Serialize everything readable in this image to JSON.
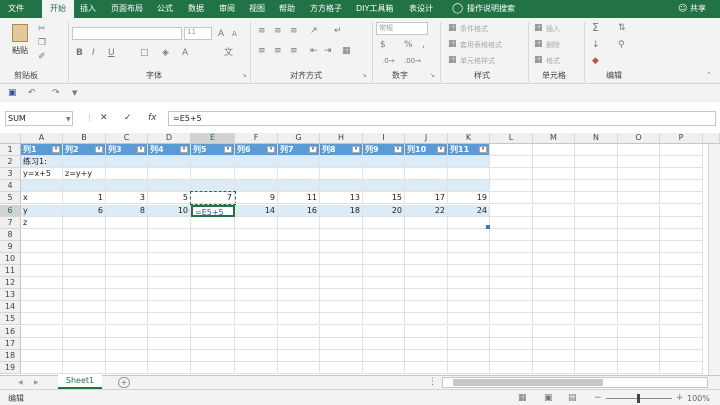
{
  "menu": {
    "file": "文件",
    "home": "开始",
    "insert": "插入",
    "page_layout": "页面布局",
    "formulas": "公式",
    "data": "数据",
    "review": "审阅",
    "view": "视图",
    "help": "帮助",
    "ffgz": "方方格子",
    "diy": "DIY工具箱",
    "design": "表设计",
    "tellme": "操作说明搜索",
    "share": "共享"
  },
  "ribbon": {
    "clipboard": {
      "paste": "粘贴",
      "label": "剪贴板"
    },
    "font": {
      "size": "11",
      "bold": "B",
      "italic": "I",
      "underline": "U",
      "grow": "A",
      "shrink": "A",
      "color_a": "A",
      "wen": "文",
      "label": "字体"
    },
    "alignment": {
      "label": "对齐方式"
    },
    "number": {
      "format": "常规",
      "currency": "$",
      "percent": "%",
      "comma": ",",
      "label": "数字"
    },
    "styles": {
      "cond": "条件格式",
      "table": "套用表格格式",
      "cell": "单元格样式",
      "label": "样式"
    },
    "cells": {
      "insert": "插入",
      "delete": "删除",
      "format": "格式",
      "label": "单元格"
    },
    "editing": {
      "sum": "Σ",
      "label": "编辑"
    }
  },
  "formula_bar": {
    "name_box": "SUM",
    "cancel": "✕",
    "enter": "✓",
    "fx": "fx",
    "formula": "=E5+5"
  },
  "grid": {
    "columns": [
      "A",
      "B",
      "C",
      "D",
      "E",
      "F",
      "G",
      "H",
      "I",
      "J",
      "K",
      "L",
      "M",
      "N",
      "O",
      "P"
    ],
    "rows": [
      "1",
      "2",
      "3",
      "4",
      "5",
      "6",
      "7",
      "8",
      "9",
      "10",
      "11",
      "12",
      "13",
      "14",
      "15",
      "16",
      "17",
      "18",
      "19"
    ],
    "header_row": [
      "列1",
      "列2",
      "列3",
      "列4",
      "列5",
      "列6",
      "列7",
      "列8",
      "列9",
      "列10",
      "列11"
    ],
    "r2": [
      "练习1:"
    ],
    "r3": [
      "y=x+5",
      "z=y+y"
    ],
    "r5": [
      "x",
      "1",
      "3",
      "5",
      "7",
      "9",
      "11",
      "13",
      "15",
      "17",
      "19"
    ],
    "r6": [
      "y",
      "6",
      "8",
      "10",
      "=E5+5",
      "14",
      "16",
      "18",
      "20",
      "22",
      "24"
    ],
    "r7": [
      "z"
    ]
  },
  "tabs": {
    "sheet1": "Sheet1",
    "add": "+"
  },
  "status": {
    "mode": "编辑",
    "zoom": "100%"
  },
  "colors": {
    "ribbon_green": "#217346",
    "table_header": "#5b9bd5",
    "band": "#ddebf7",
    "active_cell": "#217346"
  }
}
